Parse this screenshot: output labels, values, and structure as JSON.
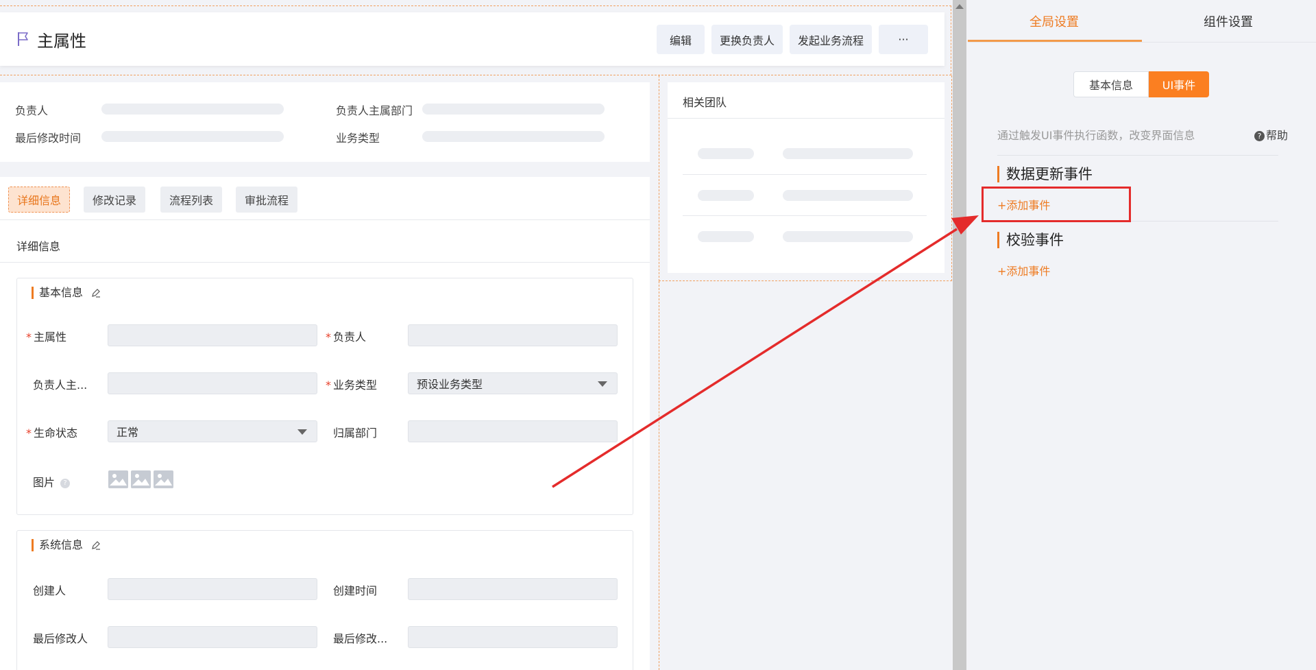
{
  "header": {
    "title": "主属性",
    "buttons": [
      "编辑",
      "更换负责人",
      "发起业务流程",
      "···"
    ]
  },
  "info": {
    "owner_label": "负责人",
    "owner_dept_label": "负责人主属部门",
    "last_modified_label": "最后修改时间",
    "business_type_label": "业务类型"
  },
  "tabs": [
    "详细信息",
    "修改记录",
    "流程列表",
    "审批流程"
  ],
  "detail": {
    "section_title": "详细信息",
    "basic_group": {
      "title": "基本信息",
      "main_attr_label": "主属性",
      "owner_label": "负责人",
      "owner_dept_label": "负责人主...",
      "business_type_label": "业务类型",
      "business_type_value": "预设业务类型",
      "life_status_label": "生命状态",
      "life_status_value": "正常",
      "dept_label": "归属部门",
      "image_label": "图片"
    },
    "system_group": {
      "title": "系统信息",
      "creator_label": "创建人",
      "created_time_label": "创建时间",
      "last_modifier_label": "最后修改人",
      "last_modified_label": "最后修改..."
    }
  },
  "team": {
    "title": "相关团队"
  },
  "panel": {
    "tabs": [
      "全局设置",
      "组件设置"
    ],
    "active_tab": "全局设置",
    "segment": [
      "基本信息",
      "UI事件"
    ],
    "hint": "通过触发UI事件执行函数，改变界面信息",
    "help": "帮助",
    "events": [
      {
        "title": "数据更新事件",
        "add_label": "+添加事件"
      },
      {
        "title": "校验事件",
        "add_label": "+添加事件"
      }
    ]
  },
  "colors": {
    "accent": "#fb7f21",
    "highlight": "#e42b2b",
    "dashed_outline": "#f0a060"
  }
}
